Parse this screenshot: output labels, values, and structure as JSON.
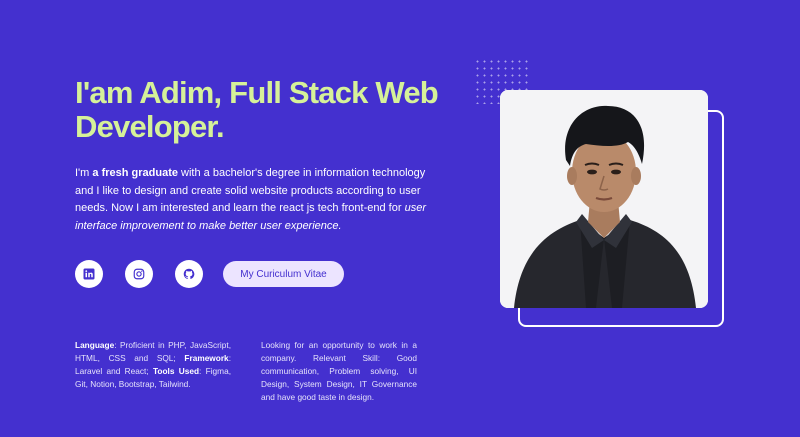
{
  "hero": {
    "title": "I'am Adim, Full Stack Web Developer."
  },
  "intro": {
    "part1": "I'm ",
    "bold": "a fresh graduate",
    "part2": " with a bachelor's degree in information technology and I like to design and create solid website products according to user needs. Now I am interested and learn the react js tech front-end for ",
    "italic": "user interface improvement to make better user experience."
  },
  "socials": [
    {
      "name": "linkedin-icon"
    },
    {
      "name": "instagram-icon"
    },
    {
      "name": "github-icon"
    }
  ],
  "cv_button": {
    "label": "My Curiculum Vitae"
  },
  "skills": {
    "language_label": "Language",
    "language_text": ": Proficient in PHP, JavaScript, HTML, CSS and SQL; ",
    "framework_label": "Framework",
    "framework_text": ": Laravel and React; ",
    "tools_label": "Tools Used",
    "tools_text": ": Figma, Git, Notion, Bootstrap, Tailwind."
  },
  "looking": {
    "text": "Looking for an opportunity to work in a company. Relevant Skill: Good communication, Problem solving, UI Design, System Design, IT Governance and have good taste in design."
  },
  "colors": {
    "background": "#4430cf",
    "accent": "#d6f199",
    "button_bg": "#ece4ff"
  }
}
